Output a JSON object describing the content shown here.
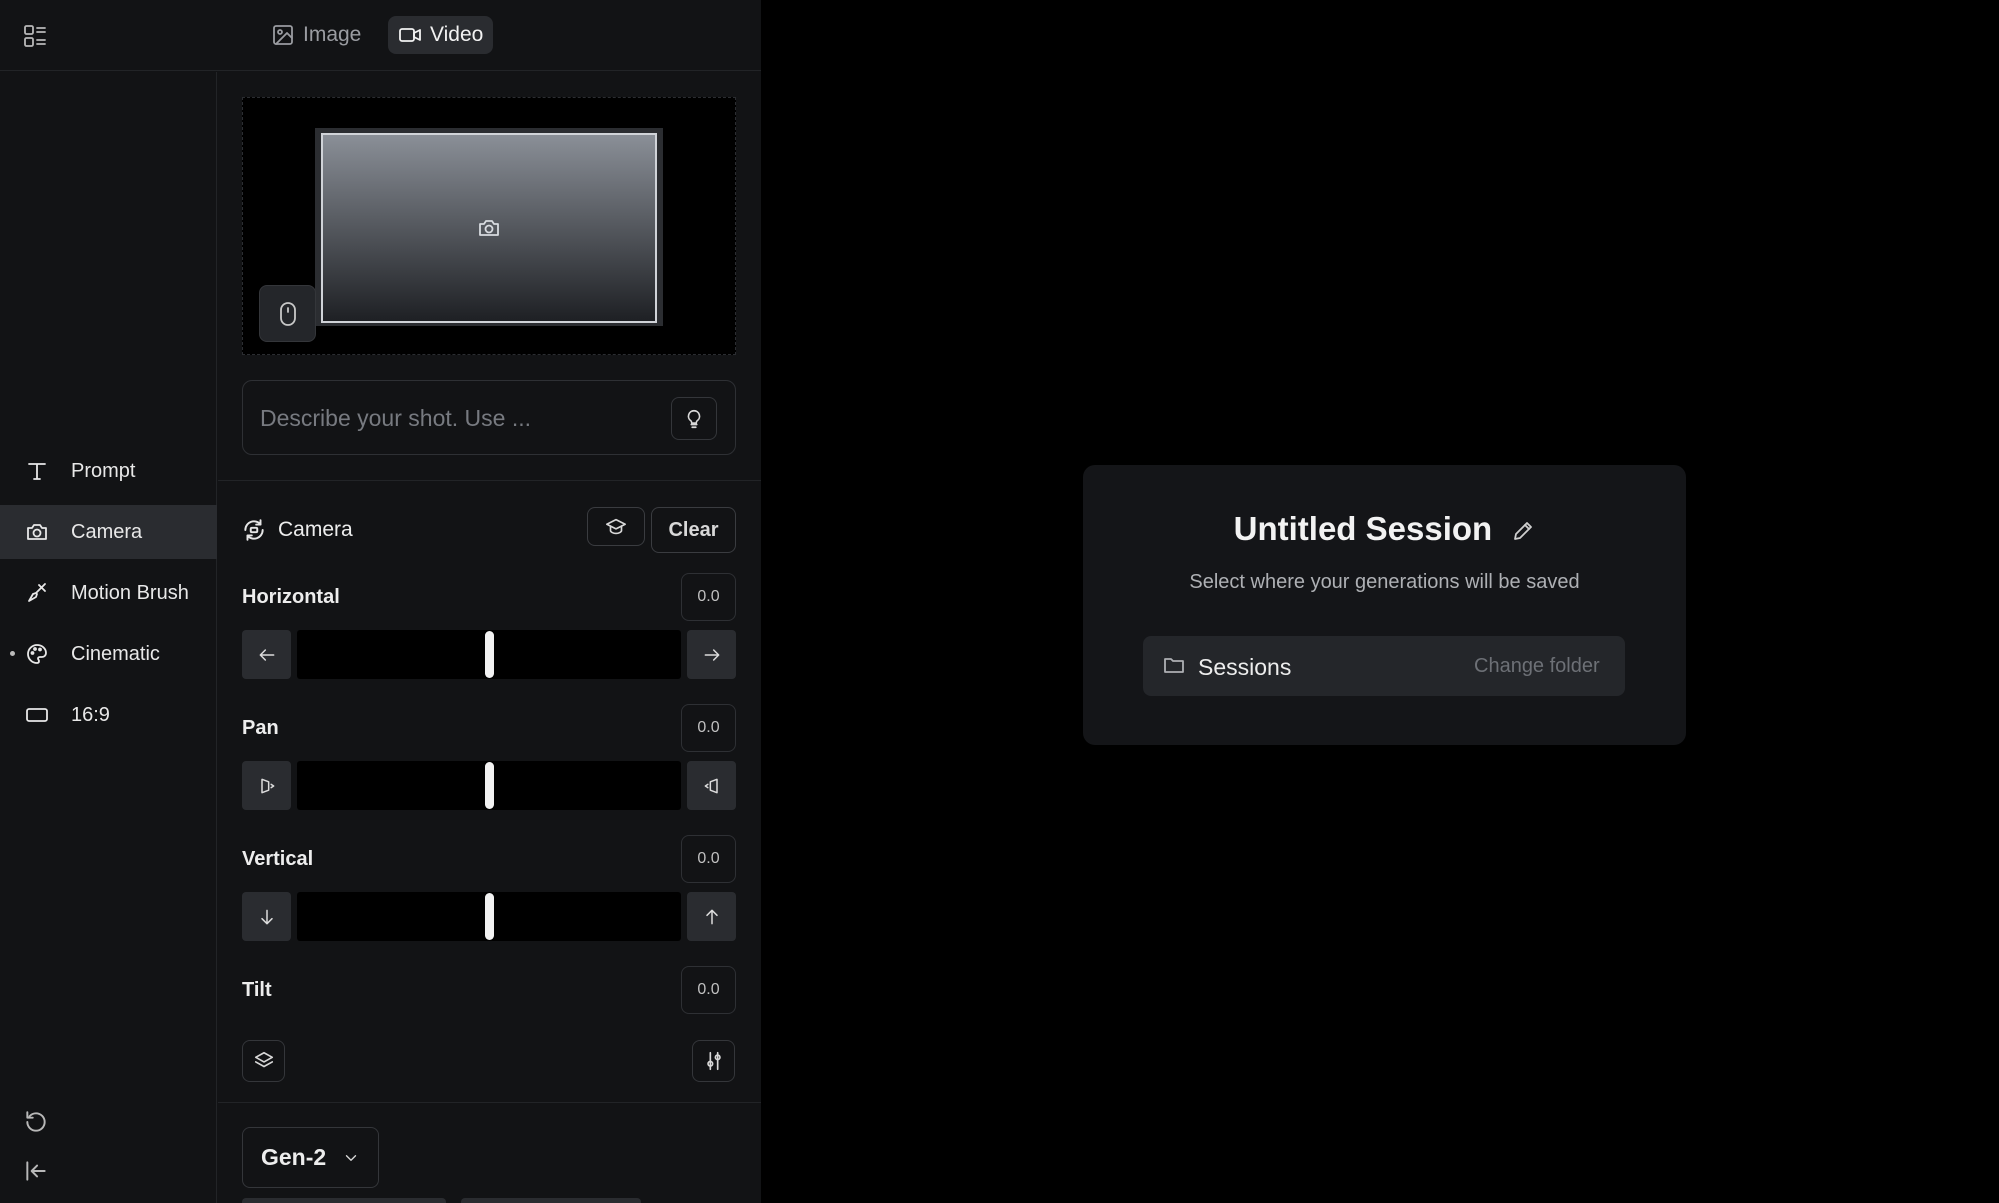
{
  "topbar": {
    "tabs": [
      {
        "label": "Image",
        "icon": "image-icon",
        "active": false
      },
      {
        "label": "Video",
        "icon": "video-icon",
        "active": true
      }
    ]
  },
  "sidebar": {
    "items": [
      {
        "label": "Prompt",
        "icon": "text-icon"
      },
      {
        "label": "Camera",
        "icon": "camera-icon",
        "active": true
      },
      {
        "label": "Motion Brush",
        "icon": "brush-icon"
      },
      {
        "label": "Cinematic",
        "icon": "palette-icon",
        "has_dot": true
      },
      {
        "label": "16:9",
        "icon": "aspect-ratio-icon"
      }
    ]
  },
  "prompt": {
    "placeholder": "Describe your shot. Use ..."
  },
  "camera": {
    "title": "Camera",
    "clear_label": "Clear",
    "controls": [
      {
        "label": "Horizontal",
        "value": "0.0",
        "level": 0
      },
      {
        "label": "Pan",
        "value": "0.0",
        "level": 0
      },
      {
        "label": "Vertical",
        "value": "0.0",
        "level": 0
      },
      {
        "label": "Tilt",
        "value": "0.0",
        "level": 0
      }
    ]
  },
  "model": {
    "selected": "Gen-2"
  },
  "session": {
    "title": "Untitled Session",
    "subtitle": "Select where your generations will be saved",
    "folder_name": "Sessions",
    "change_folder_label": "Change folder"
  },
  "colors": {
    "panel_bg": "#121315",
    "active_bg": "#2a2c30",
    "canvas_bg": "#000000",
    "card_bg": "#141518"
  }
}
